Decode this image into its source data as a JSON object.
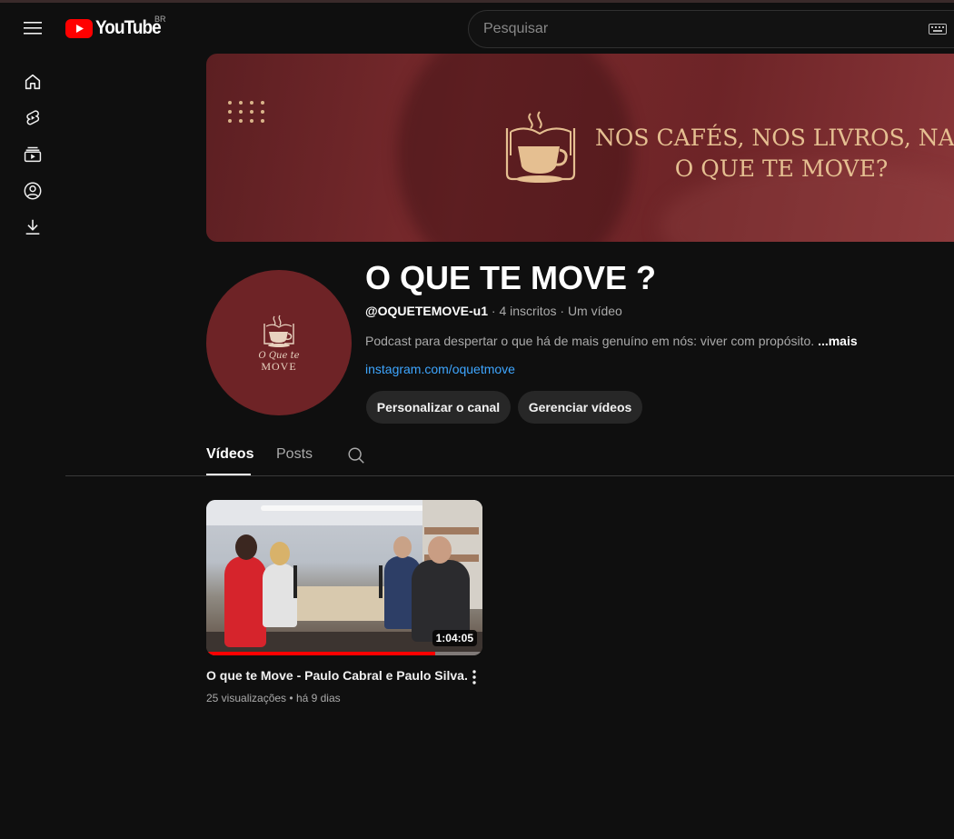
{
  "masthead": {
    "logo_text": "YouTube",
    "country_code": "BR",
    "search_placeholder": "Pesquisar"
  },
  "sidebar": {
    "icons": [
      "home-icon",
      "shorts-icon",
      "subscriptions-icon",
      "you-icon",
      "downloads-icon"
    ]
  },
  "banner": {
    "line1": "NOS CAFÉS, NOS LIVROS, NA VIDA",
    "line2": "O QUE TE MOVE?"
  },
  "channel": {
    "avatar_line1": "O Que te",
    "avatar_line2": "MOVE",
    "title": "O QUE TE MOVE ?",
    "handle": "@OQUETEMOVE-u1",
    "subscribers": "4 inscritos",
    "video_count": "Um vídeo",
    "separator": " · ",
    "description": "Podcast para despertar o que há de mais genuíno em nós: viver com propósito. ",
    "more": "...mais",
    "link": "instagram.com/oquetmove"
  },
  "buttons": {
    "customize": "Personalizar o canal",
    "manage": "Gerenciar vídeos"
  },
  "tabs": [
    {
      "label": "Vídeos",
      "active": true
    },
    {
      "label": "Posts",
      "active": false
    }
  ],
  "video": {
    "title": "O que te Move - Paulo Cabral e Paulo Silva.",
    "views": "25 visualizações",
    "age": "há 9 dias",
    "meta_separator": " • ",
    "duration": "1:04:05",
    "watched_fraction": 0.83
  },
  "colors": {
    "background": "#0f0f0f",
    "youtube_red": "#ff0000",
    "banner_maroon": "#6e2326",
    "banner_gold": "#e5bf91",
    "link_blue": "#3ea6ff"
  }
}
